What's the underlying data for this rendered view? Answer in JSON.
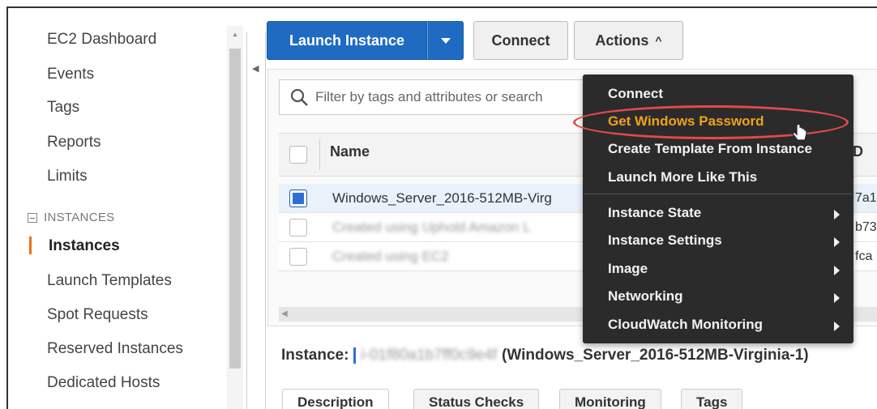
{
  "sidebar": {
    "items": [
      {
        "label": "EC2 Dashboard"
      },
      {
        "label": "Events"
      },
      {
        "label": "Tags"
      },
      {
        "label": "Reports"
      },
      {
        "label": "Limits"
      }
    ],
    "section_label": "INSTANCES",
    "section_items": [
      {
        "label": "Instances",
        "active": true
      },
      {
        "label": "Launch Templates"
      },
      {
        "label": "Spot Requests"
      },
      {
        "label": "Reserved Instances"
      },
      {
        "label": "Dedicated Hosts"
      }
    ]
  },
  "toolbar": {
    "launch_label": "Launch Instance",
    "connect_label": "Connect",
    "actions_label": "Actions",
    "actions_caret": "^"
  },
  "filter": {
    "placeholder": "Filter by tags and attributes or search"
  },
  "table": {
    "columns": [
      {
        "label": "Name"
      },
      {
        "label": "ID"
      }
    ],
    "rows": [
      {
        "name": "Windows_Server_2016-512MB-Virg",
        "id": "7a1",
        "selected": true,
        "name_blurred": false
      },
      {
        "name": "Created using Uphold Amazon L",
        "id": "b73",
        "selected": false,
        "name_blurred": true
      },
      {
        "name": "Created using EC2",
        "id": "fca",
        "selected": false,
        "name_blurred": true
      }
    ]
  },
  "detail": {
    "label": "Instance:",
    "instance_id_blurred": "i-01f80a1b7ff0c9e4f",
    "instance_name": "(Windows_Server_2016-512MB-Virginia-1)"
  },
  "tabs": [
    {
      "label": "Description"
    },
    {
      "label": "Status Checks"
    },
    {
      "label": "Monitoring"
    },
    {
      "label": "Tags"
    }
  ],
  "actions_menu": {
    "items": [
      {
        "label": "Connect",
        "submenu": false
      },
      {
        "label": "Get Windows Password",
        "submenu": false,
        "highlighted": true
      },
      {
        "label": "Create Template From Instance",
        "submenu": false
      },
      {
        "label": "Launch More Like This",
        "submenu": false
      },
      {
        "label": "Instance State",
        "submenu": true
      },
      {
        "label": "Instance Settings",
        "submenu": true
      },
      {
        "label": "Image",
        "submenu": true
      },
      {
        "label": "Networking",
        "submenu": true
      },
      {
        "label": "CloudWatch Monitoring",
        "submenu": true
      }
    ]
  },
  "colors": {
    "primary_button": "#1f6bc2",
    "highlight": "#f0a21a",
    "annotation": "#e14a4a",
    "active_nav": "#ec7211"
  }
}
